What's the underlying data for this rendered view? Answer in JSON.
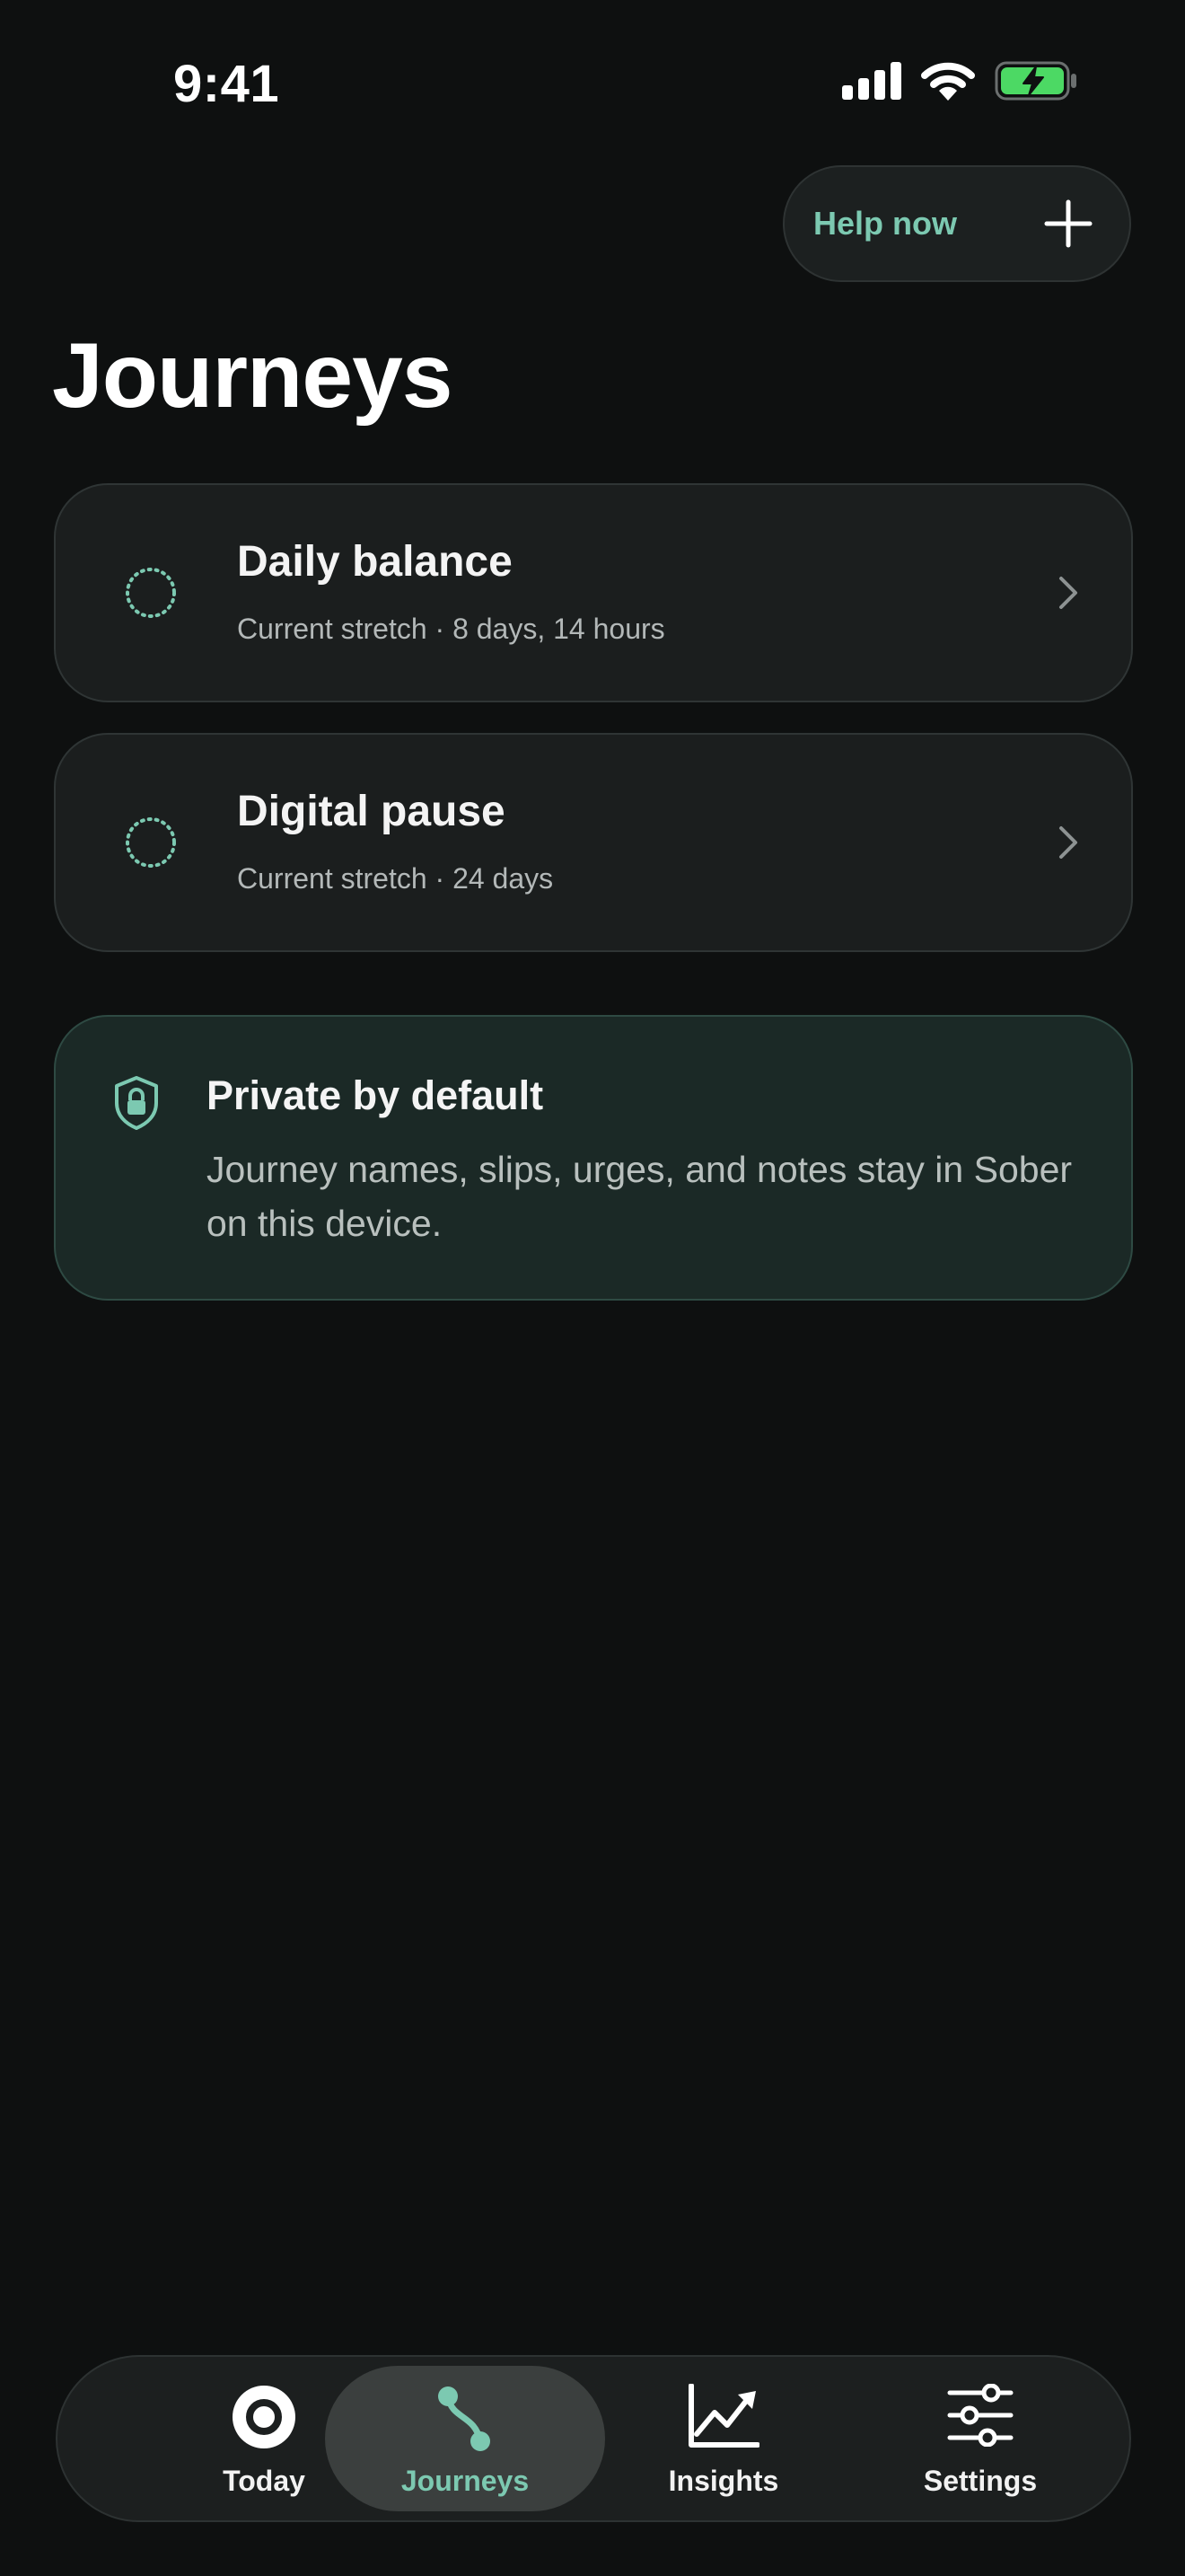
{
  "status_bar": {
    "time": "9:41"
  },
  "header": {
    "help_button_label": "Help now",
    "title": "Journeys"
  },
  "journeys": [
    {
      "title": "Daily balance",
      "subtitle": "Current stretch · 8 days, 14 hours"
    },
    {
      "title": "Digital pause",
      "subtitle": "Current stretch · 24 days"
    }
  ],
  "privacy": {
    "title": "Private by default",
    "body": "Journey names, slips, urges, and notes stay in Sober on this device."
  },
  "tab_bar": {
    "tabs": [
      {
        "label": "Today",
        "icon": "today-icon",
        "active": false
      },
      {
        "label": "Journeys",
        "icon": "journeys-icon",
        "active": true
      },
      {
        "label": "Insights",
        "icon": "insights-icon",
        "active": false
      },
      {
        "label": "Settings",
        "icon": "settings-icon",
        "active": false
      }
    ]
  },
  "colors": {
    "background": "#0e1010",
    "accent": "#7cc9b1",
    "card": "#1b1e1e",
    "privacy_card": "#1b2926",
    "battery": "#4cd964"
  }
}
